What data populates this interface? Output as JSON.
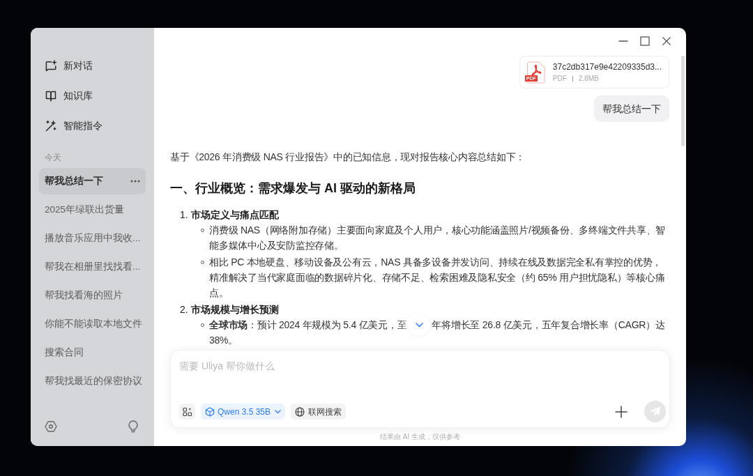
{
  "sidebar": {
    "nav": [
      {
        "kind": "new_chat",
        "label": "新对话"
      },
      {
        "kind": "knowledge",
        "label": "知识库"
      },
      {
        "kind": "commands",
        "label": "智能指令"
      }
    ],
    "section_label": "今天",
    "history": [
      {
        "title": "帮我总结一下",
        "selected": true
      },
      {
        "title": "2025年绿联出货量",
        "selected": false
      },
      {
        "title": "播放音乐应用中我收...",
        "selected": false
      },
      {
        "title": "帮我在相册里找找看...",
        "selected": false
      },
      {
        "title": "帮我找看海的照片",
        "selected": false
      },
      {
        "title": "你能不能读取本地文件",
        "selected": false
      },
      {
        "title": "搜索合同",
        "selected": false
      },
      {
        "title": "帮我找最近的保密协议",
        "selected": false
      }
    ]
  },
  "attachment": {
    "icon_label": "PDF",
    "file_name": "37c2db317e9e42209335d3...",
    "file_type": "PDF",
    "file_size": "2.8MB"
  },
  "user_message": "帮我总结一下",
  "response": {
    "intro": "基于《2026 年消费级 NAS 行业报告》中的已知信息，现对报告核心内容总结如下：",
    "heading": "一、行业概览：需求爆发与 AI 驱动的新格局",
    "sections": [
      {
        "number": "1.",
        "title": "市场定义与痛点匹配",
        "bullets": [
          {
            "text": "消费级 NAS（网络附加存储）主要面向家庭及个人用户，核心功能涵盖照片/视频备份、多终端文件共享、智能多媒体中心及安防监控存储。"
          },
          {
            "text": "相比 PC 本地硬盘、移动设备及公有云，NAS 具备多设备并发访问、持续在线及数据完全私有掌控的优势，精准解决了当代家庭面临的数据碎片化、存储不足、检索困难及隐私安全（约 65% 用户担忧隐私）等核心痛点。"
          }
        ]
      },
      {
        "number": "2.",
        "title": "市场规模与增长预测",
        "bullets": [
          {
            "lines": [
              [
                "**全球市场**：预计 2024 年规模为 5.4 亿美元，至",
                "年将增长至 26.8 亿美元，五年复合增长率（CAGR）达"
              ],
              [
                "38%。"
              ]
            ]
          }
        ]
      }
    ]
  },
  "composer": {
    "placeholder": "需要 Uliya 帮你做什么",
    "model": "Qwen 3.5 35B",
    "web_search": {
      "label": "联网搜索",
      "on": false
    },
    "send_disabled": true
  },
  "footer_note": "结果由 AI 生成，仅供参考"
}
